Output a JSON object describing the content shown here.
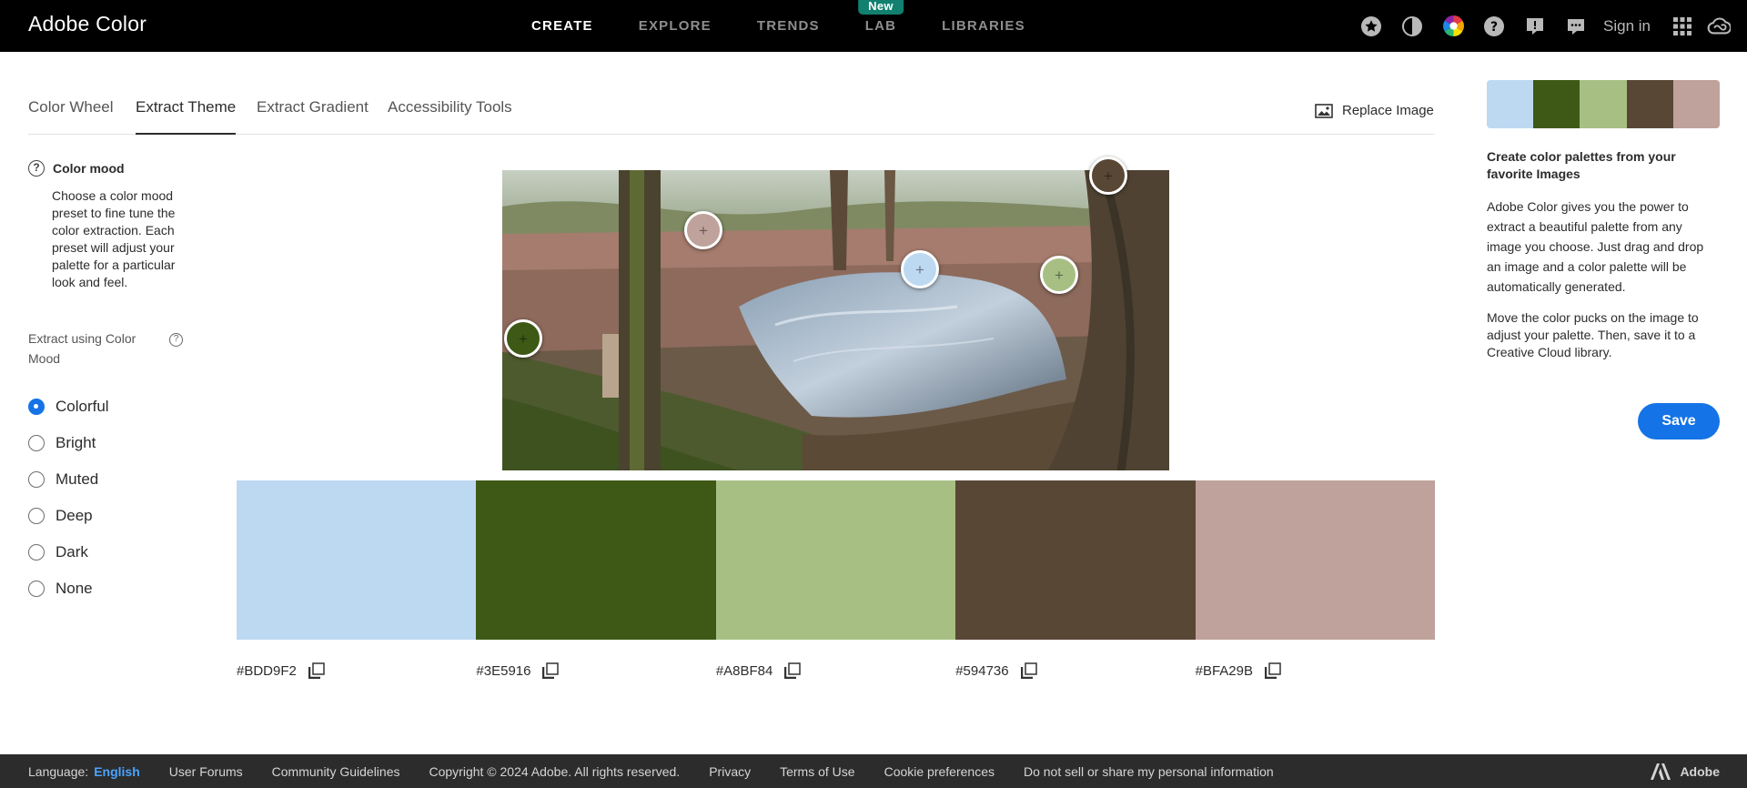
{
  "app": {
    "brand": "Adobe Color",
    "sign_in": "Sign in"
  },
  "nav": [
    {
      "label": "CREATE",
      "active": true
    },
    {
      "label": "EXPLORE",
      "active": false
    },
    {
      "label": "TRENDS",
      "active": false
    },
    {
      "label": "LAB",
      "active": false,
      "badge": "New"
    },
    {
      "label": "LIBRARIES",
      "active": false
    }
  ],
  "toolbar_icons": [
    "star-icon",
    "contrast-icon",
    "color-wheel-icon",
    "help-icon",
    "feedback-icon",
    "chat-icon",
    "apps-grid-icon",
    "creative-cloud-icon"
  ],
  "tabs": [
    {
      "label": "Color Wheel",
      "active": false
    },
    {
      "label": "Extract Theme",
      "active": true
    },
    {
      "label": "Extract Gradient",
      "active": false
    },
    {
      "label": "Accessibility Tools",
      "active": false
    }
  ],
  "replace_image": "Replace Image",
  "color_mood": {
    "title": "Color mood",
    "description": "Choose a color mood preset to fine tune the color extraction. Each preset will adjust your palette for a particular look and feel.",
    "extract_label": "Extract using Color Mood",
    "options": [
      {
        "label": "Colorful",
        "selected": true
      },
      {
        "label": "Bright",
        "selected": false
      },
      {
        "label": "Muted",
        "selected": false
      },
      {
        "label": "Deep",
        "selected": false
      },
      {
        "label": "Dark",
        "selected": false
      },
      {
        "label": "None",
        "selected": false
      }
    ]
  },
  "palette": [
    {
      "hex": "#BDD9F2",
      "color": "#BDD9F2"
    },
    {
      "hex": "#3E5916",
      "color": "#3E5916"
    },
    {
      "hex": "#A8BF84",
      "color": "#A8BF84"
    },
    {
      "hex": "#594736",
      "color": "#594736"
    },
    {
      "hex": "#BFA29B",
      "color": "#BFA29B"
    }
  ],
  "right_panel": {
    "title": "Create color palettes from your favorite Images",
    "para1": "Adobe Color gives you the power to extract a beautiful palette from any image you choose. Just drag and drop an image and a color palette will be automatically generated.",
    "para2": "Move the color pucks on the image to adjust your palette. Then, save it to a Creative Cloud library.",
    "save": "Save"
  },
  "footer": {
    "language_label": "Language:",
    "language": "English",
    "links": [
      "User Forums",
      "Community Guidelines",
      "Copyright © 2024 Adobe. All rights reserved.",
      "Privacy",
      "Terms of Use",
      "Cookie preferences",
      "Do not sell or share my personal information"
    ],
    "adobe": "Adobe"
  }
}
